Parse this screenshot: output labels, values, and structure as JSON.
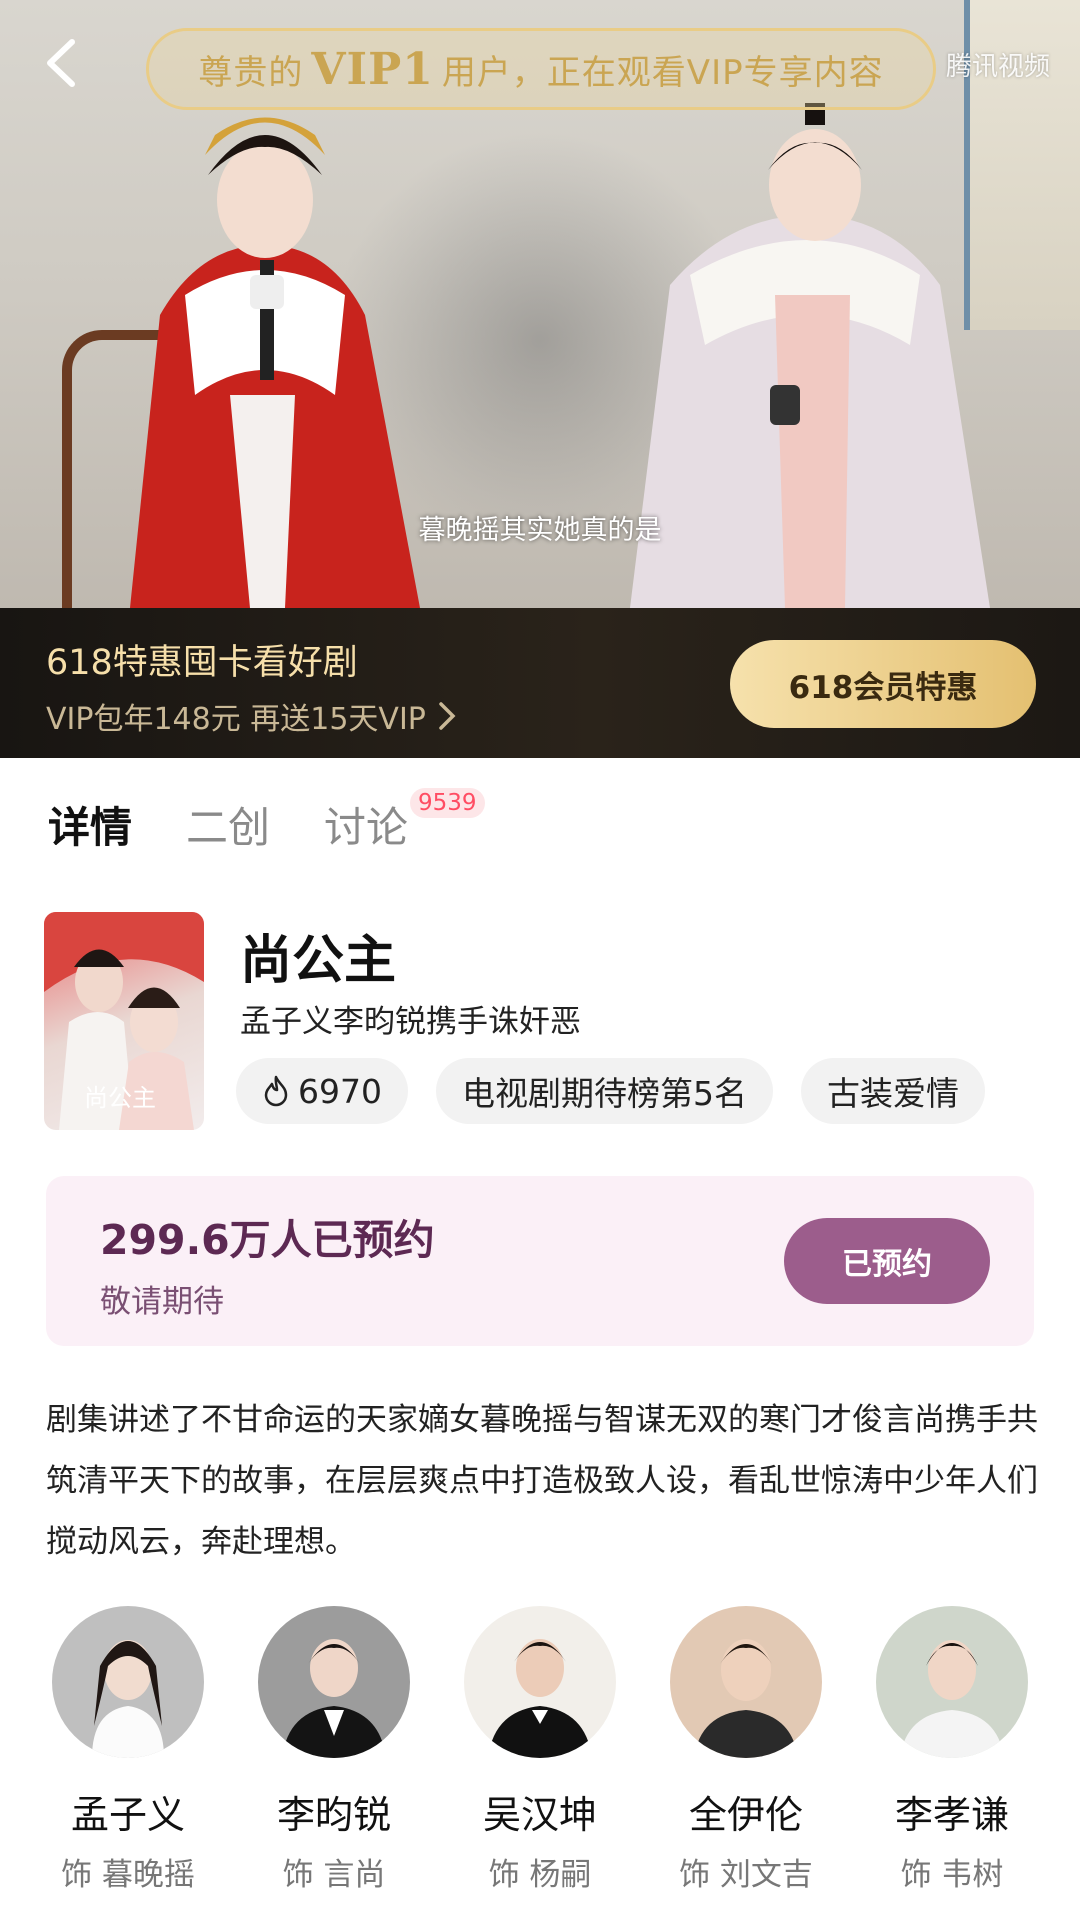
{
  "player": {
    "vip_banner": {
      "prefix": "尊贵的",
      "level": "VIP1",
      "suffix": "用户，正在观看VIP专享内容"
    },
    "watermark": "腾讯视频",
    "subtitle": "暮晚摇其实她真的是",
    "back_icon": "chevron-left-icon"
  },
  "promo": {
    "title": "618特惠囤卡看好剧",
    "subtitle": "VIP包年148元 再送15天VIP",
    "button": "618会员特惠",
    "colors": {
      "button": "#e8c777",
      "text": "#f6dfaa"
    }
  },
  "tabs": [
    {
      "label": "详情",
      "active": true
    },
    {
      "label": "二创",
      "active": false
    },
    {
      "label": "讨论",
      "active": false,
      "badge": "9539"
    }
  ],
  "show": {
    "poster_text": "尚公主",
    "title": "尚公主",
    "tagline": "孟子义李昀锐携手诛奸恶",
    "chips": [
      {
        "icon": "flame-icon",
        "label": "6970"
      },
      {
        "label": "电视剧期待榜第5名"
      },
      {
        "label": "古装爱情"
      }
    ]
  },
  "reserve": {
    "count": "299.6万人已预约",
    "hint": "敬请期待",
    "button": "已预约",
    "colors": {
      "card": "#fbf0f7",
      "button": "#9c5d8c"
    }
  },
  "description": "剧集讲述了不甘命运的天家嫡女暮晚摇与智谋无双的寒门才俊言尚携手共筑清平天下的故事，在层层爽点中打造极致人设，看乱世惊涛中少年人们搅动风云，奔赴理想。",
  "cast": [
    {
      "name": "孟子义",
      "role": "饰 暮晚摇"
    },
    {
      "name": "李昀锐",
      "role": "饰 言尚"
    },
    {
      "name": "吴汉坤",
      "role": "饰 杨嗣"
    },
    {
      "name": "全伊伦",
      "role": "饰 刘文吉"
    },
    {
      "name": "李孝谦",
      "role": "饰 韦树"
    }
  ]
}
